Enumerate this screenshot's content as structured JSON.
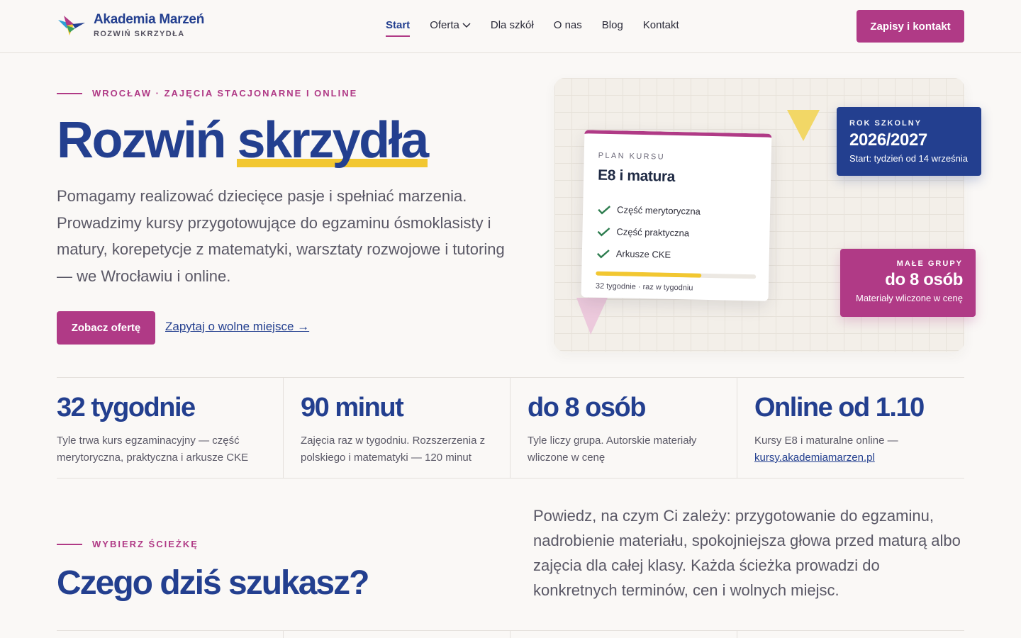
{
  "brand": {
    "name": "Akademia Marzeń",
    "tagline": "ROZWIŃ SKRZYDŁA"
  },
  "nav": {
    "items": [
      {
        "label": "Start",
        "active": true
      },
      {
        "label": "Oferta",
        "dropdown": true
      },
      {
        "label": "Dla szkół"
      },
      {
        "label": "O nas"
      },
      {
        "label": "Blog"
      },
      {
        "label": "Kontakt"
      }
    ],
    "cta": "Zapisy i kontakt"
  },
  "hero": {
    "eyebrow": "WROCŁAW · ZAJĘCIA STACJONARNE I ONLINE",
    "title_main": "Rozwiń",
    "title_highlight": "skrzydła",
    "text": "Pomagamy realizować dziecięce pasje i spełniać marzenia. Prowadzimy kursy przygotowujące do egzaminu ósmoklasisty i matury, korepetycje z matematyki, warsztaty rozwojowe i tutoring — we Wrocławiu i online.",
    "primary_button": "Zobacz ofertę",
    "secondary_link": "Zapytaj o wolne miejsce →"
  },
  "plan_card": {
    "label": "PLAN KURSU",
    "title": "E8 i matura",
    "items": [
      "Część merytoryczna",
      "Część praktyczna",
      "Arkusze CKE"
    ],
    "progress": 0.66,
    "meta": "32 tygodnie · raz w tygodniu"
  },
  "badge_year": {
    "label": "ROK SZKOLNY",
    "value": "2026/2027",
    "sub": "Start: tydzień od 14 września"
  },
  "badge_groups": {
    "label": "MAŁE GRUPY",
    "value": "do 8 osób",
    "sub": "Materiały wliczone w cenę"
  },
  "stats": [
    {
      "value": "32 tygodnie",
      "desc": "Tyle trwa kurs egzaminacyjny — część merytoryczna, praktyczna i arkusze CKE"
    },
    {
      "value": "90 minut",
      "desc": "Zajęcia raz w tygodniu. Rozszerzenia z polskiego i matematyki — 120 minut"
    },
    {
      "value": "do 8 osób",
      "desc": "Tyle liczy grupa. Autorskie materiały wliczone w cenę"
    },
    {
      "value": "Online od 1.10",
      "desc": "Kursy E8 i maturalne online —",
      "link": "kursy.akademiamarzen.pl"
    }
  ],
  "section": {
    "eyebrow": "WYBIERZ ŚCIEŻKĘ",
    "title": "Czego dziś szukasz?",
    "text": "Powiedz, na czym Ci zależy: przygotowanie do egzaminu, nadrobienie materiału, spokojniejsza głowa przed maturą albo zajęcia dla całej klasy. Każda ścieżka prowadzi do konkretnych terminów, cen i wolnych miejsc."
  },
  "colors": {
    "brand_blue": "#233f8f",
    "brand_pink": "#b03a86",
    "accent_yellow": "#f2c731",
    "check_green": "#2e7d4f",
    "background": "#faf8f6"
  },
  "icons": {
    "logo": "bird-logo-icon",
    "dropdown": "chevron-down-icon",
    "check": "check-icon"
  }
}
